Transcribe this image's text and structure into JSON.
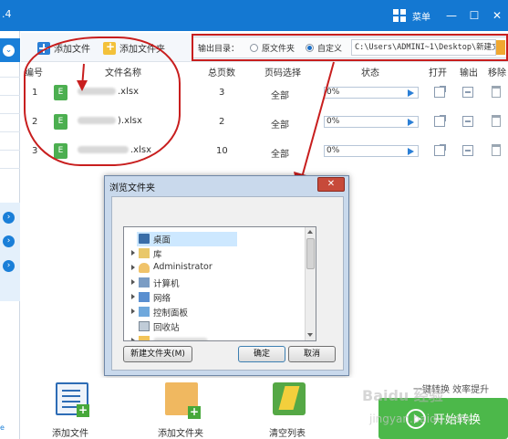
{
  "titlebar": {
    "version": ".4",
    "menu_label": "菜单",
    "minimize": "—",
    "maximize": "☐",
    "close": "✕"
  },
  "toolbar": {
    "add_file": "添加文件",
    "add_folder": "添加文件夹",
    "output_dir_label": "输出目录：",
    "option_original": "原文件夹",
    "option_custom": "自定义",
    "path_value": "C:\\Users\\ADMINI~1\\Desktop\\新建文"
  },
  "table": {
    "headers": [
      "编号",
      "文件名称",
      "总页数",
      "页码选择",
      "状态",
      "打开",
      "输出",
      "移除"
    ],
    "rows": [
      {
        "no": "1",
        "name": ".xlsx",
        "pages": "3",
        "page_select": "全部",
        "progress": "0%"
      },
      {
        "no": "2",
        "name": ").xlsx",
        "pages": "2",
        "page_select": "全部",
        "progress": "0%"
      },
      {
        "no": "3",
        "name": ".xlsx",
        "pages": "10",
        "page_select": "全部",
        "progress": "0%"
      }
    ],
    "file_icon_letter": "E"
  },
  "dialog": {
    "title": "浏览文件夹",
    "close": "✕",
    "tree": [
      {
        "label": "桌面",
        "icon": "desktop-icon",
        "expander": false,
        "selected": true
      },
      {
        "label": "库",
        "icon": "library-icon",
        "expander": true
      },
      {
        "label": "Administrator",
        "icon": "user-icon",
        "expander": true
      },
      {
        "label": "计算机",
        "icon": "computer-icon",
        "expander": true
      },
      {
        "label": "网络",
        "icon": "network-icon",
        "expander": true
      },
      {
        "label": "控制面板",
        "icon": "control-panel-icon",
        "expander": true
      },
      {
        "label": "回收站",
        "icon": "recycle-bin-icon",
        "expander": false
      },
      {
        "label": "",
        "icon": "folder-icon",
        "expander": true
      }
    ],
    "new_folder_btn": "新建文件夹(M)",
    "ok_btn": "确定",
    "cancel_btn": "取消"
  },
  "bottom": {
    "add_file": "添加文件",
    "add_folder": "添加文件夹",
    "clear_list": "清空列表",
    "slogan": "一键转换  效率提升",
    "start": "开始转换"
  },
  "watermark": {
    "line1": "Baidu 经验",
    "line2": "jingyan.baidu.com"
  },
  "colors": {
    "titlebar": "#1478d2",
    "annotation_red": "#c81e1e",
    "start_green": "#4cb84a"
  }
}
